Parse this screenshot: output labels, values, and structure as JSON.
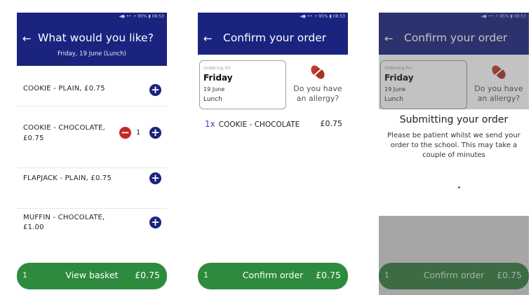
{
  "status_bar": {
    "p1": "◂● •• .• 95% ▮ 08:53",
    "p2": "◂● •• .• 95% ▮ 08:53",
    "p3": "◂● •• .• 95% ▮ 08:53"
  },
  "back_icon": "←",
  "screen_menu": {
    "title": "What would you like?",
    "subtitle": "Friday, 19 June (Lunch)",
    "items": [
      {
        "name_line1": "COOKIE - PLAIN, £0.75",
        "name_line2": ""
      },
      {
        "name_line1": "COOKIE - CHOCOLATE,",
        "name_line2": "£0.75",
        "quantity": "1"
      },
      {
        "name_line1": "FLAPJACK - PLAIN, £0.75",
        "name_line2": ""
      },
      {
        "name_line1": "MUFFIN - CHOCOLATE,",
        "name_line2": "£1.00"
      }
    ],
    "plus_icon": "+",
    "minus_icon": "−",
    "basket": {
      "count": "1",
      "label": "View basket",
      "total": "£0.75"
    }
  },
  "screen_confirm": {
    "title": "Confirm your order",
    "card": {
      "label": "Ordering for",
      "day": "Friday",
      "date": "19 June",
      "meal": "Lunch"
    },
    "allergy_line1": "Do you have",
    "allergy_line2": "an allergy?",
    "order_line": {
      "quantity": "1x",
      "name": "COOKIE - CHOCOLATE",
      "price": "£0.75"
    },
    "confirm": {
      "count": "1",
      "label": "Confirm order",
      "total": "£0.75"
    }
  },
  "screen_submitting": {
    "title": "Confirm your order",
    "card": {
      "label": "Ordering for",
      "day": "Friday",
      "date": "19 June",
      "meal": "Lunch"
    },
    "allergy_line1": "Do you have",
    "allergy_line2": "an allergy?",
    "dialog_title": "Submitting your order",
    "dialog_body": "Please be patient whilst we send your order to the school. This may take a couple of minutes",
    "confirm": {
      "count": "1",
      "label": "Confirm order",
      "total": "£0.75"
    }
  },
  "icons": {
    "allergy": "nut-allergy-icon",
    "spinner": "loading-spinner-icon"
  },
  "colors": {
    "primary": "#1a237e",
    "accent_green": "#2e8b3d",
    "minus_red": "#c62828",
    "allergy_red": "#c0392b"
  }
}
